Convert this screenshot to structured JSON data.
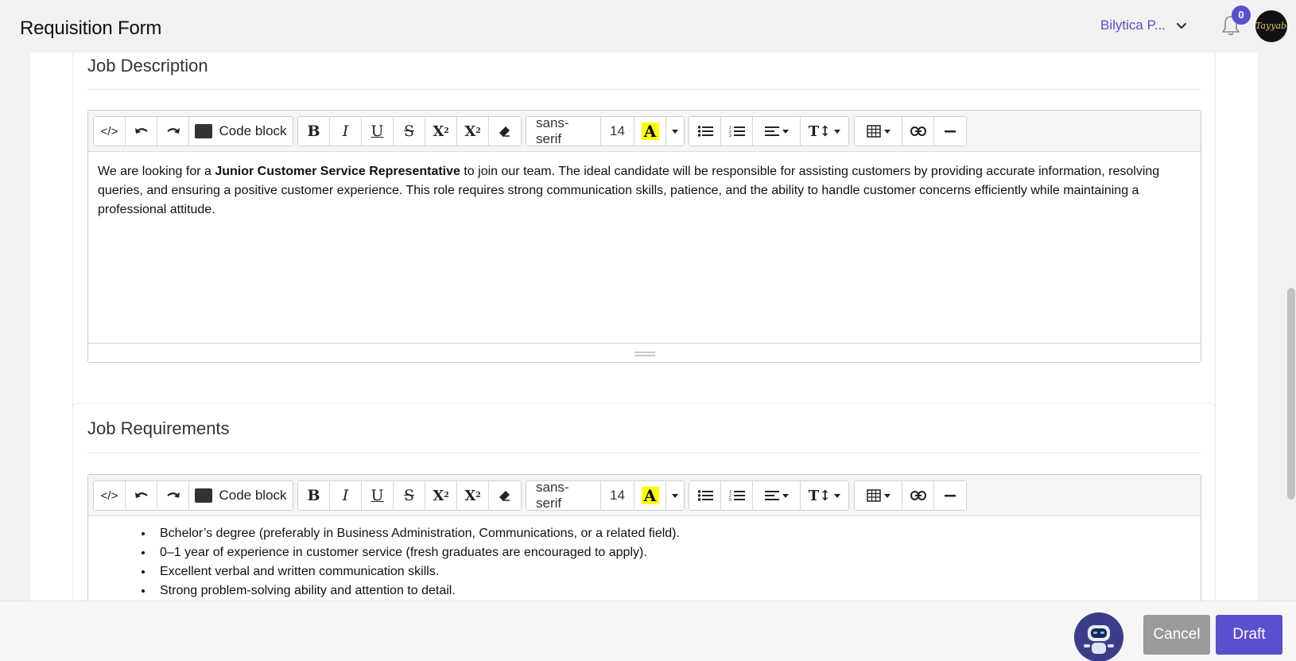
{
  "header": {
    "title": "Requisition Form",
    "org_name": "Bilytica P...",
    "notifications_count": "0",
    "avatar_text": "Tayyaba"
  },
  "editor_toolbar": {
    "code_view_label": "</>",
    "code_block_label": "Code block",
    "font_family": "sans-serif",
    "font_size": "14",
    "highlight_label": "A"
  },
  "job_description": {
    "title": "Job Description",
    "text_before": "We are looking for a ",
    "text_bold": "Junior Customer Service Representative",
    "text_after": " to join our team. The ideal candidate will be responsible for assisting customers by providing accurate information, resolving queries, and ensuring a positive customer experience. This role requires strong communication skills, patience, and the ability to handle customer concerns efficiently while maintaining a professional attitude."
  },
  "job_requirements": {
    "title": "Job Requirements",
    "items": [
      "Bchelor’s degree (preferably in Business Administration, Communications, or a related field).",
      "0–1 year of experience in customer service (fresh graduates are encouraged to apply).",
      "Excellent verbal and written communication skills.",
      "Strong problem-solving ability and attention to detail."
    ]
  },
  "footer": {
    "cancel_label": "Cancel",
    "draft_label": "Draft"
  },
  "colors": {
    "accent": "#5a4fcf",
    "cancel": "#9a9a9a",
    "highlight": "#ffff00"
  }
}
